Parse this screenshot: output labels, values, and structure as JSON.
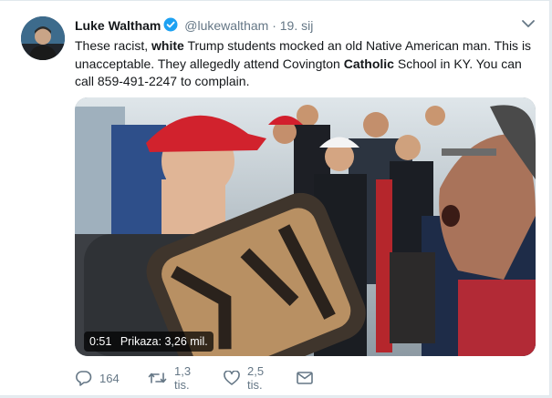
{
  "tweet": {
    "author_name": "Luke Waltham",
    "handle": "@lukewaltham",
    "separator": "·",
    "date": "19. sij",
    "text_parts": {
      "p1": "These racist, ",
      "b1": "white",
      "p2": " Trump students mocked an old Native American man.  This is unacceptable. They allegedly attend Covington ",
      "b2": "Catholic",
      "p3": " School in KY. You can call 859-491-2247 to complain."
    }
  },
  "video": {
    "duration": "0:51",
    "views": "Prikaza: 3,26 mil."
  },
  "actions": {
    "reply_count": "164",
    "retweet_count": "1,3 tis.",
    "like_count": "2,5 tis."
  },
  "colors": {
    "verified": "#1da1f2",
    "icon_gray": "#657786"
  }
}
